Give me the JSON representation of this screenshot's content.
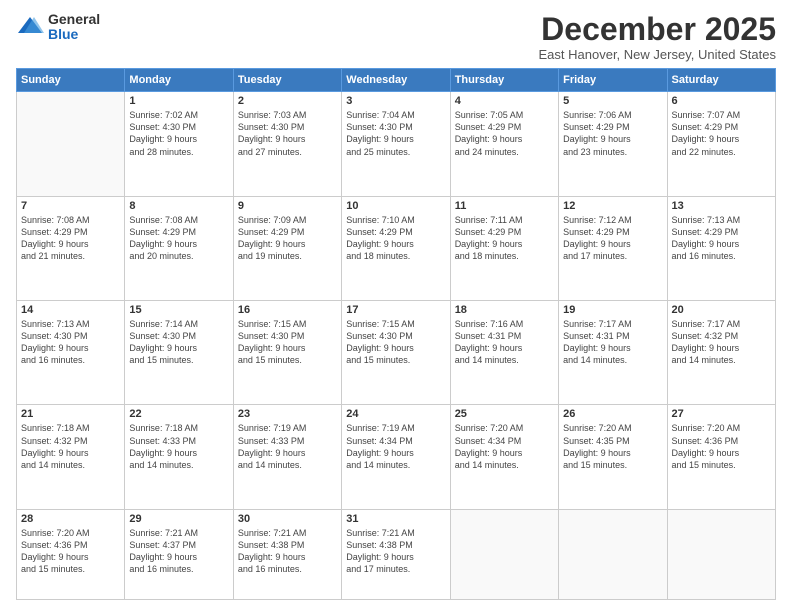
{
  "logo": {
    "general": "General",
    "blue": "Blue"
  },
  "header": {
    "month": "December 2025",
    "location": "East Hanover, New Jersey, United States"
  },
  "weekdays": [
    "Sunday",
    "Monday",
    "Tuesday",
    "Wednesday",
    "Thursday",
    "Friday",
    "Saturday"
  ],
  "weeks": [
    [
      {
        "day": "",
        "info": ""
      },
      {
        "day": "1",
        "info": "Sunrise: 7:02 AM\nSunset: 4:30 PM\nDaylight: 9 hours\nand 28 minutes."
      },
      {
        "day": "2",
        "info": "Sunrise: 7:03 AM\nSunset: 4:30 PM\nDaylight: 9 hours\nand 27 minutes."
      },
      {
        "day": "3",
        "info": "Sunrise: 7:04 AM\nSunset: 4:30 PM\nDaylight: 9 hours\nand 25 minutes."
      },
      {
        "day": "4",
        "info": "Sunrise: 7:05 AM\nSunset: 4:29 PM\nDaylight: 9 hours\nand 24 minutes."
      },
      {
        "day": "5",
        "info": "Sunrise: 7:06 AM\nSunset: 4:29 PM\nDaylight: 9 hours\nand 23 minutes."
      },
      {
        "day": "6",
        "info": "Sunrise: 7:07 AM\nSunset: 4:29 PM\nDaylight: 9 hours\nand 22 minutes."
      }
    ],
    [
      {
        "day": "7",
        "info": "Sunrise: 7:08 AM\nSunset: 4:29 PM\nDaylight: 9 hours\nand 21 minutes."
      },
      {
        "day": "8",
        "info": "Sunrise: 7:08 AM\nSunset: 4:29 PM\nDaylight: 9 hours\nand 20 minutes."
      },
      {
        "day": "9",
        "info": "Sunrise: 7:09 AM\nSunset: 4:29 PM\nDaylight: 9 hours\nand 19 minutes."
      },
      {
        "day": "10",
        "info": "Sunrise: 7:10 AM\nSunset: 4:29 PM\nDaylight: 9 hours\nand 18 minutes."
      },
      {
        "day": "11",
        "info": "Sunrise: 7:11 AM\nSunset: 4:29 PM\nDaylight: 9 hours\nand 18 minutes."
      },
      {
        "day": "12",
        "info": "Sunrise: 7:12 AM\nSunset: 4:29 PM\nDaylight: 9 hours\nand 17 minutes."
      },
      {
        "day": "13",
        "info": "Sunrise: 7:13 AM\nSunset: 4:29 PM\nDaylight: 9 hours\nand 16 minutes."
      }
    ],
    [
      {
        "day": "14",
        "info": "Sunrise: 7:13 AM\nSunset: 4:30 PM\nDaylight: 9 hours\nand 16 minutes."
      },
      {
        "day": "15",
        "info": "Sunrise: 7:14 AM\nSunset: 4:30 PM\nDaylight: 9 hours\nand 15 minutes."
      },
      {
        "day": "16",
        "info": "Sunrise: 7:15 AM\nSunset: 4:30 PM\nDaylight: 9 hours\nand 15 minutes."
      },
      {
        "day": "17",
        "info": "Sunrise: 7:15 AM\nSunset: 4:30 PM\nDaylight: 9 hours\nand 15 minutes."
      },
      {
        "day": "18",
        "info": "Sunrise: 7:16 AM\nSunset: 4:31 PM\nDaylight: 9 hours\nand 14 minutes."
      },
      {
        "day": "19",
        "info": "Sunrise: 7:17 AM\nSunset: 4:31 PM\nDaylight: 9 hours\nand 14 minutes."
      },
      {
        "day": "20",
        "info": "Sunrise: 7:17 AM\nSunset: 4:32 PM\nDaylight: 9 hours\nand 14 minutes."
      }
    ],
    [
      {
        "day": "21",
        "info": "Sunrise: 7:18 AM\nSunset: 4:32 PM\nDaylight: 9 hours\nand 14 minutes."
      },
      {
        "day": "22",
        "info": "Sunrise: 7:18 AM\nSunset: 4:33 PM\nDaylight: 9 hours\nand 14 minutes."
      },
      {
        "day": "23",
        "info": "Sunrise: 7:19 AM\nSunset: 4:33 PM\nDaylight: 9 hours\nand 14 minutes."
      },
      {
        "day": "24",
        "info": "Sunrise: 7:19 AM\nSunset: 4:34 PM\nDaylight: 9 hours\nand 14 minutes."
      },
      {
        "day": "25",
        "info": "Sunrise: 7:20 AM\nSunset: 4:34 PM\nDaylight: 9 hours\nand 14 minutes."
      },
      {
        "day": "26",
        "info": "Sunrise: 7:20 AM\nSunset: 4:35 PM\nDaylight: 9 hours\nand 15 minutes."
      },
      {
        "day": "27",
        "info": "Sunrise: 7:20 AM\nSunset: 4:36 PM\nDaylight: 9 hours\nand 15 minutes."
      }
    ],
    [
      {
        "day": "28",
        "info": "Sunrise: 7:20 AM\nSunset: 4:36 PM\nDaylight: 9 hours\nand 15 minutes."
      },
      {
        "day": "29",
        "info": "Sunrise: 7:21 AM\nSunset: 4:37 PM\nDaylight: 9 hours\nand 16 minutes."
      },
      {
        "day": "30",
        "info": "Sunrise: 7:21 AM\nSunset: 4:38 PM\nDaylight: 9 hours\nand 16 minutes."
      },
      {
        "day": "31",
        "info": "Sunrise: 7:21 AM\nSunset: 4:38 PM\nDaylight: 9 hours\nand 17 minutes."
      },
      {
        "day": "",
        "info": ""
      },
      {
        "day": "",
        "info": ""
      },
      {
        "day": "",
        "info": ""
      }
    ]
  ]
}
